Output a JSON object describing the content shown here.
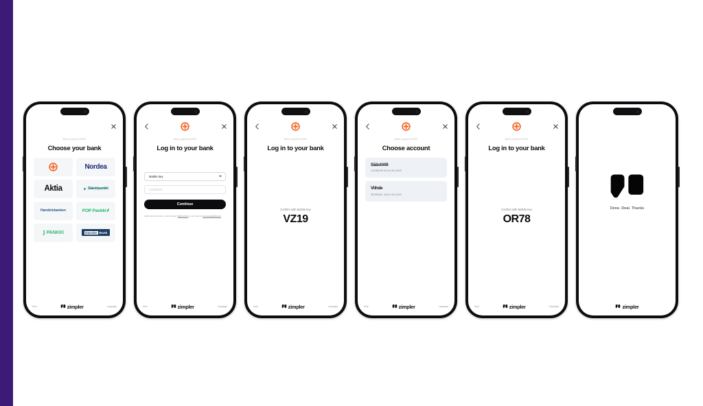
{
  "page": {
    "background": "#ffffff",
    "accent_stripe_color": "#3d1a78",
    "brand_orange": "#f26322",
    "brand_black": "#0c0c0e"
  },
  "footer": {
    "help_label": "Help",
    "brand_name": "zimpler",
    "language_label": "Language"
  },
  "common": {
    "payment_label": "Bank payment €200",
    "back_icon": "chevron-left-icon",
    "close_icon": "close-icon",
    "bank_icon": "op-bank-logo-icon"
  },
  "screens": [
    {
      "id": "choose-bank",
      "title": "Choose your bank",
      "payment_label": "Bank payment €200",
      "has_back": false,
      "banks": [
        {
          "id": "op",
          "label": "OP",
          "type": "logo-op",
          "color": "#f26322"
        },
        {
          "id": "nordea",
          "label": "Nordea",
          "type": "text",
          "color": "#1c2a78"
        },
        {
          "id": "aktia",
          "label": "Aktia",
          "type": "text",
          "color": "#0a0a0a"
        },
        {
          "id": "saastopankki",
          "label": "Säästöpankki",
          "type": "text",
          "color": "#0f6e72"
        },
        {
          "id": "handelsbanken",
          "label": "Handelsbanken",
          "type": "text",
          "color": "#2b5a8e"
        },
        {
          "id": "pop-pankki",
          "label": "POP Pankki",
          "type": "text",
          "color": "#20b871"
        },
        {
          "id": "s-pankki",
          "label": "PANKKI",
          "type": "text",
          "color": "#3fb878"
        },
        {
          "id": "danske-bank",
          "label": "Danske",
          "label2": "Bank",
          "type": "boxed",
          "color": "#1b3f64"
        }
      ]
    },
    {
      "id": "login-form",
      "title": "Log in to your bank",
      "payment_label": "Bank payment €200",
      "has_back": true,
      "form": {
        "method_select_value": "Mobile key",
        "method_options": [
          "Mobile key"
        ],
        "user_id_placeholder": "12345678",
        "user_id_value": "",
        "submit_label": "Continue",
        "legal_prefix": "Jatkamalla vahvistan, että hyväksyn ",
        "legal_link1": "käyttöehdot",
        "legal_middle": " ja olen lukenut ",
        "legal_link2": "tietosuojakäytännön",
        "legal_suffix": "."
      }
    },
    {
      "id": "confirm-vz19",
      "title": "Log in to your bank",
      "payment_label": "Bank payment €200",
      "has_back": true,
      "confirm": {
        "label": "Confirm with Mobile key",
        "code": "VZ19"
      }
    },
    {
      "id": "choose-account",
      "title": "Choose account",
      "payment_label": "Bank payment €200",
      "has_back": true,
      "accounts": [
        {
          "name": "Säästötili",
          "number": "123456789 01234 IKS-5003"
        },
        {
          "name": "Viihde",
          "number": "987554321 43210 IKS-0002"
        }
      ]
    },
    {
      "id": "confirm-or78",
      "title": "Log in to your bank",
      "payment_label": "Bank payment €200",
      "has_back": true,
      "confirm": {
        "label": "Confirm with Mobile key",
        "code": "OR78"
      }
    },
    {
      "id": "success",
      "has_back": false,
      "success": {
        "message": "Done. Deal. Thanks",
        "mark": "zimpler-m-mark-icon"
      }
    }
  ]
}
